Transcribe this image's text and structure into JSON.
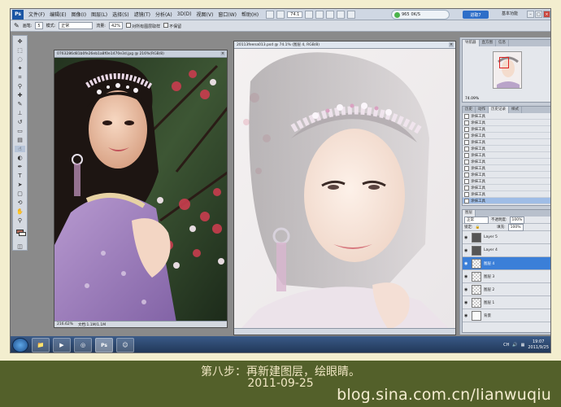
{
  "menubar": {
    "logo": "Ps",
    "items": [
      "文件(F)",
      "编辑(E)",
      "图像(I)",
      "图层(L)",
      "选择(S)",
      "滤镜(T)",
      "分析(A)",
      "3D(D)",
      "视图(V)",
      "窗口(W)",
      "帮助(H)"
    ],
    "zoom": "74.1",
    "system_widget": {
      "value_a": "965",
      "value_b": "0K/S"
    },
    "enter_button": "进取7",
    "workspace": "基本功能"
  },
  "optionsbar": {
    "brush_label": "画笔:",
    "brush_size": "5",
    "mode_label": "模式:",
    "mode_value": "正常",
    "opacity_label": "不透明度:",
    "opacity_value": "100%",
    "flow_label": "流量:",
    "flow_value": "42%",
    "option_a": "对所有图层取样",
    "option_b": "不保留"
  },
  "doc1": {
    "title": "0763286d81b0fe26eb1a8f0e1470e3d.jpg @ 216%(RGB/8)",
    "status_zoom": "216.62%",
    "status_doc": "文档:1.1M/1.1M"
  },
  "doc2": {
    "title": "20113feena013.psd @ 74.1% (图层 4, RGB/8)",
    "status_zoom": "",
    "status_doc": ""
  },
  "navigator": {
    "tabs": [
      "导航器",
      "直方图",
      "信息"
    ],
    "zoom": "74.09%"
  },
  "history": {
    "tabs": [
      "历史",
      "动作",
      "历史记录",
      "样式"
    ],
    "items": [
      "涂抹工具",
      "涂抹工具",
      "涂抹工具",
      "涂抹工具",
      "涂抹工具",
      "涂抹工具",
      "涂抹工具",
      "涂抹工具",
      "涂抹工具",
      "涂抹工具",
      "涂抹工具",
      "涂抹工具",
      "涂抹工具",
      "涂抹工具"
    ]
  },
  "layers": {
    "tab": "图层",
    "blend_mode": "正常",
    "opacity_label": "不透明度:",
    "opacity_value": "100%",
    "lock_label": "锁定:",
    "fill_label": "填充:",
    "fill_value": "100%",
    "items": [
      {
        "name": "Layer 5",
        "thumb": "dark",
        "selected": false
      },
      {
        "name": "Layer 4",
        "thumb": "dark",
        "selected": false
      },
      {
        "name": "图层 4",
        "thumb": "checker",
        "selected": true
      },
      {
        "name": "图层 3",
        "thumb": "checker",
        "selected": false
      },
      {
        "name": "图层 2",
        "thumb": "checker",
        "selected": false
      },
      {
        "name": "图层 1",
        "thumb": "checker",
        "selected": false
      },
      {
        "name": "背景",
        "thumb": "white",
        "selected": false
      }
    ]
  },
  "taskbar": {
    "time": "19:07",
    "date": "2011/9/25",
    "language": "CH"
  },
  "caption": {
    "line1": "第八步：再新建图层，绘眼睛。",
    "line2": "2011-09-25",
    "watermark": "blog.sina.com.cn/lianwuqiu"
  },
  "colors": {
    "caption_band": "#53602a",
    "caption_text": "#f0e6c3",
    "frame_bg": "#f3eecf",
    "selected_layer": "#3b7fd8"
  }
}
